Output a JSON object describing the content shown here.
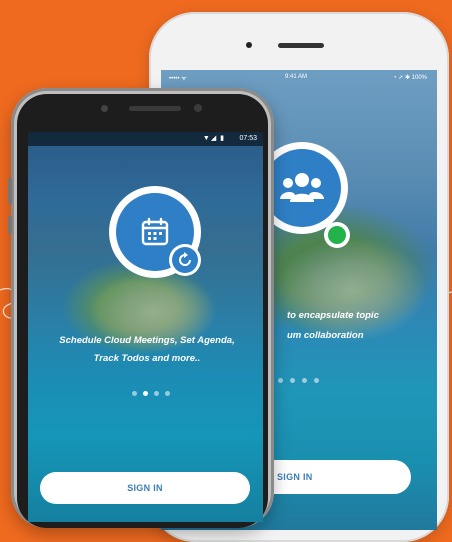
{
  "colors": {
    "background": "#EF6A1F",
    "accent_blue": "#2F7FC6",
    "online_green": "#21B24A",
    "button_text": "#3D7EB6"
  },
  "back_phone": {
    "status_bar": {
      "carrier": "••••• ᯤ",
      "time": "9:41 AM",
      "battery": "◔ ➚ ✱ 100%"
    },
    "feature_icon": "group-icon",
    "tagline_line1": "to encapsulate topic",
    "tagline_line2": "um collaboration",
    "page_dots": 4,
    "signin_label": "SIGN IN"
  },
  "front_phone": {
    "status_bar": {
      "icons": "▼◢ ▮",
      "time": "07:53"
    },
    "feature_icon": "calendar-icon",
    "badge_icon": "sync-icon",
    "tagline_line1": "Schedule Cloud Meetings, Set Agenda,",
    "tagline_line2": "Track Todos and more..",
    "page_dots": 4,
    "active_dot": 2,
    "signin_label": "SIGN IN"
  }
}
